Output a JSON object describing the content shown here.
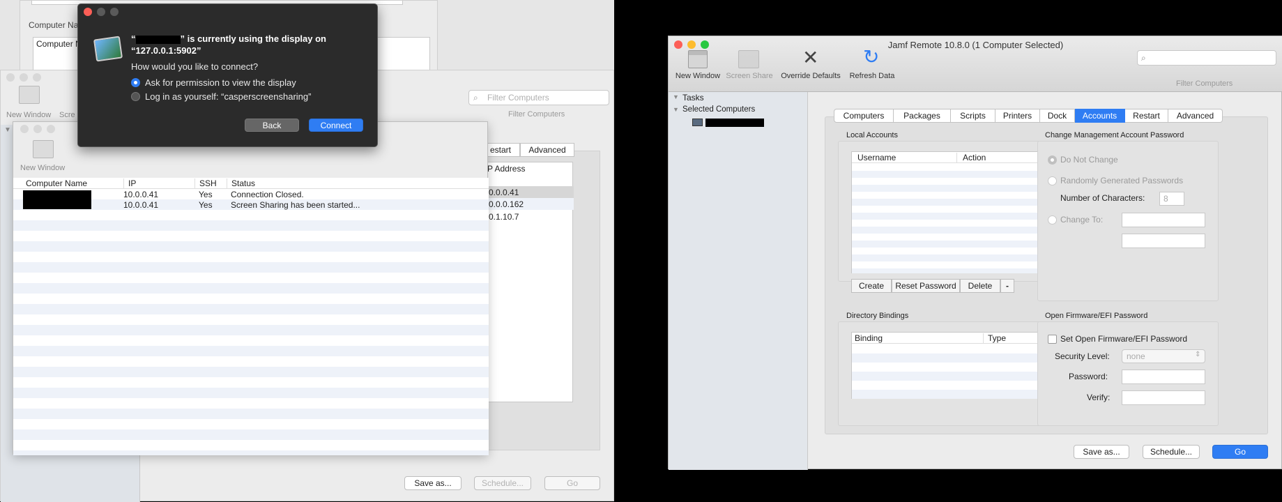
{
  "left_bg": {
    "computer_name_label": "Computer Na",
    "computer_name_header": "Computer N",
    "new_window": "New Window",
    "screen_share_partial": "Scre",
    "filter_placeholder": "Filter Computers",
    "filter_label": "Filter Computers",
    "tab_restart": "estart",
    "tab_advanced": "Advanced",
    "ip_header": "P Address",
    "ips": [
      "0.0.0.41",
      "0.0.0.162",
      "0.1.10.7"
    ],
    "save_as": "Save as...",
    "schedule": "Schedule...",
    "go": "Go"
  },
  "status_window": {
    "new_window": "New Window",
    "headers": [
      "Computer Name",
      "IP",
      "SSH",
      "Status"
    ],
    "rows": [
      {
        "ip": "10.0.0.41",
        "ssh": "Yes",
        "status": "Connection Closed."
      },
      {
        "ip": "10.0.0.41",
        "ssh": "Yes",
        "status": "Screen Sharing has been started..."
      }
    ]
  },
  "dialog": {
    "title_prefix": "“",
    "title_suffix": "” is currently using the display on",
    "title_line2": "“127.0.0.1:5902”",
    "question": "How would you like to connect?",
    "option1": "Ask for permission to view the display",
    "option2": "Log in as yourself: “casperscreensharing”",
    "back": "Back",
    "connect": "Connect"
  },
  "jamf": {
    "title": "Jamf Remote 10.8.0  (1 Computer Selected)",
    "toolbar": {
      "new_window": "New Window",
      "screen_share": "Screen Share",
      "override_defaults": "Override Defaults",
      "refresh_data": "Refresh Data",
      "filter_label": "Filter Computers"
    },
    "sidebar": {
      "tasks": "Tasks",
      "selected_computers": "Selected Computers"
    },
    "tabs": [
      "Computers",
      "Packages",
      "Scripts",
      "Printers",
      "Dock",
      "Accounts",
      "Restart",
      "Advanced"
    ],
    "local_accounts": {
      "title": "Local Accounts",
      "col_username": "Username",
      "col_action": "Action",
      "create": "Create",
      "reset_password": "Reset Password",
      "delete": "Delete",
      "minus": "-"
    },
    "mgmt": {
      "title": "Change Management Account Password",
      "do_not_change": "Do Not Change",
      "random": "Randomly Generated Passwords",
      "num_chars_label": "Number of Characters:",
      "num_chars_value": "8",
      "change_to": "Change To:"
    },
    "directory": {
      "title": "Directory Bindings",
      "col_binding": "Binding",
      "col_type": "Type"
    },
    "firmware": {
      "title": "Open Firmware/EFI Password",
      "set_label": "Set Open Firmware/EFI Password",
      "security_label": "Security Level:",
      "security_value": "none",
      "password_label": "Password:",
      "verify_label": "Verify:"
    },
    "footer": {
      "save_as": "Save as...",
      "schedule": "Schedule...",
      "go": "Go"
    }
  }
}
